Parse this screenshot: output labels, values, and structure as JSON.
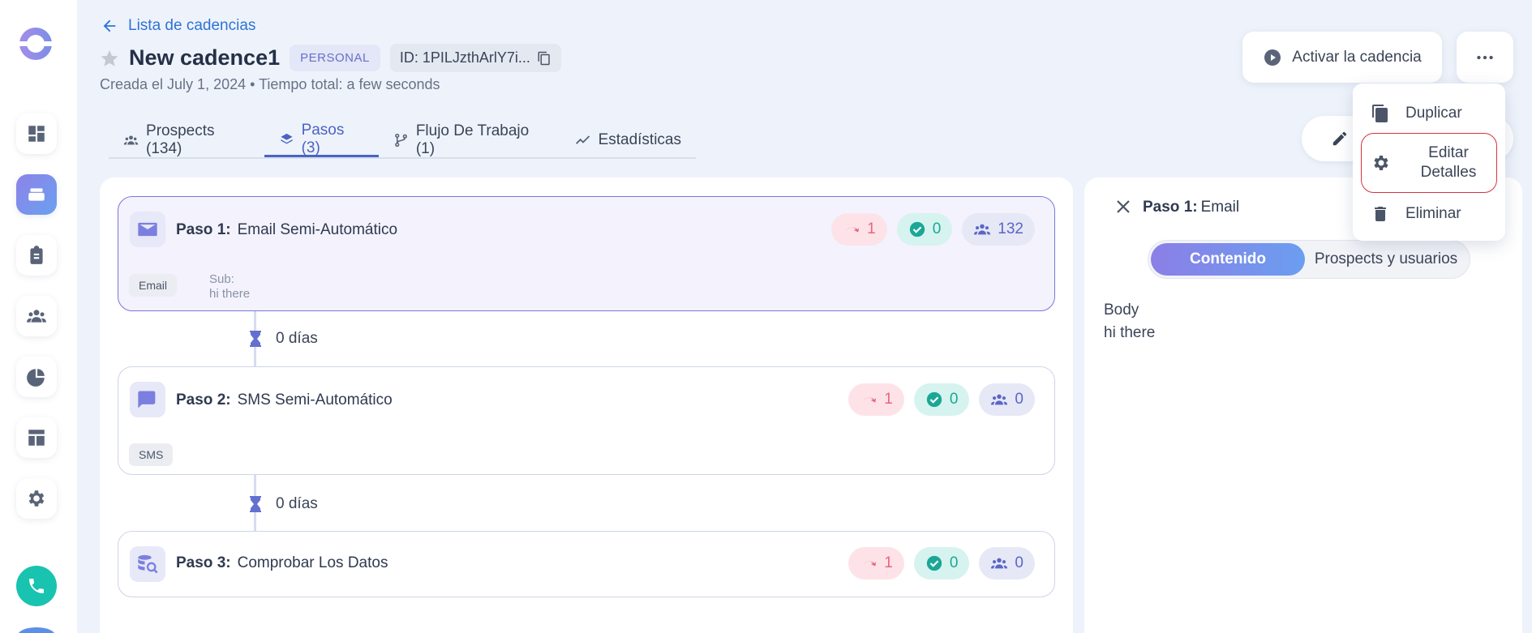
{
  "nav": {
    "back_label": "Lista de cadencias",
    "items": [
      "dashboard",
      "cadences",
      "tasks",
      "contacts",
      "reports",
      "templates",
      "settings"
    ]
  },
  "header": {
    "title": "New cadence1",
    "badge": "PERSONAL",
    "id_label": "ID: 1PILJzthArlY7i...",
    "meta": "Creada el July 1, 2024 • Tiempo total: a few seconds",
    "activate_label": "Activar la cadencia"
  },
  "tabs": [
    {
      "label": "Prospects (134)",
      "active": false
    },
    {
      "label": "Pasos (3)",
      "active": true
    },
    {
      "label": "Flujo De Trabajo (1)",
      "active": false
    },
    {
      "label": "Estadísticas",
      "active": false
    }
  ],
  "steps": [
    {
      "num": "Paso 1:",
      "name": "Email Semi-Automático",
      "tag": "Email",
      "sub_label": "Sub:",
      "sub_value": "hi there",
      "stats": [
        "1",
        "0",
        "132"
      ]
    },
    {
      "num": "Paso 2:",
      "name": "SMS Semi-Automático",
      "tag": "SMS",
      "stats": [
        "1",
        "0",
        "0"
      ]
    },
    {
      "num": "Paso 3:",
      "name": "Comprobar Los Datos",
      "stats": [
        "1",
        "0",
        "0"
      ]
    }
  ],
  "delays": [
    "0 días",
    "0 días"
  ],
  "detail": {
    "title_bold": "Paso 1:",
    "title_rest": "Email",
    "seg_active": "Contenido",
    "seg_inactive": "Prospects y usuarios",
    "body_label": "Body",
    "body_value": "hi there"
  },
  "menu": {
    "duplicate": "Duplicar",
    "edit": "Editar Detalles",
    "delete": "Eliminar"
  },
  "colors": {
    "accent": "#4a63c4",
    "brand": "#8d83e8",
    "teal": "#18c3b0",
    "danger": "#d8323f"
  }
}
